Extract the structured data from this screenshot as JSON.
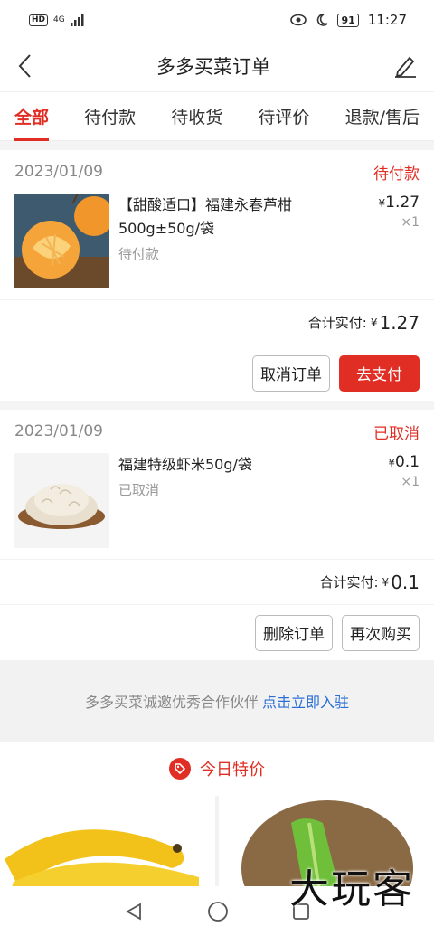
{
  "status_bar": {
    "hd": "HD",
    "signal": "4G",
    "battery": "91",
    "time": "11:27"
  },
  "nav": {
    "title": "多多买菜订单"
  },
  "tabs": [
    {
      "label": "全部",
      "active": true
    },
    {
      "label": "待付款"
    },
    {
      "label": "待收货"
    },
    {
      "label": "待评价"
    },
    {
      "label": "退款/售后"
    }
  ],
  "orders": [
    {
      "date": "2023/01/09",
      "status": "待付款",
      "item_name": "【甜酸适口】福建永春芦柑500g±50g/袋",
      "item_status": "待付款",
      "currency": "¥",
      "price": "1.27",
      "qty": "×1",
      "total_label": "合计实付:",
      "total": "1.27",
      "buttons": [
        "取消订单",
        "去支付"
      ]
    },
    {
      "date": "2023/01/09",
      "status": "已取消",
      "item_name": "福建特级虾米50g/袋",
      "item_status": "已取消",
      "currency": "¥",
      "price": "0.1",
      "qty": "×1",
      "total_label": "合计实付:",
      "total": "0.1",
      "buttons": [
        "删除订单",
        "再次购买"
      ]
    }
  ],
  "partner": {
    "text": "多多买菜诚邀优秀合作伙伴",
    "link": "点击立即入驻"
  },
  "today": {
    "label": "今日特价"
  },
  "watermark": "大玩客",
  "colors": {
    "accent": "#e02e24",
    "link": "#2a6fd6"
  }
}
